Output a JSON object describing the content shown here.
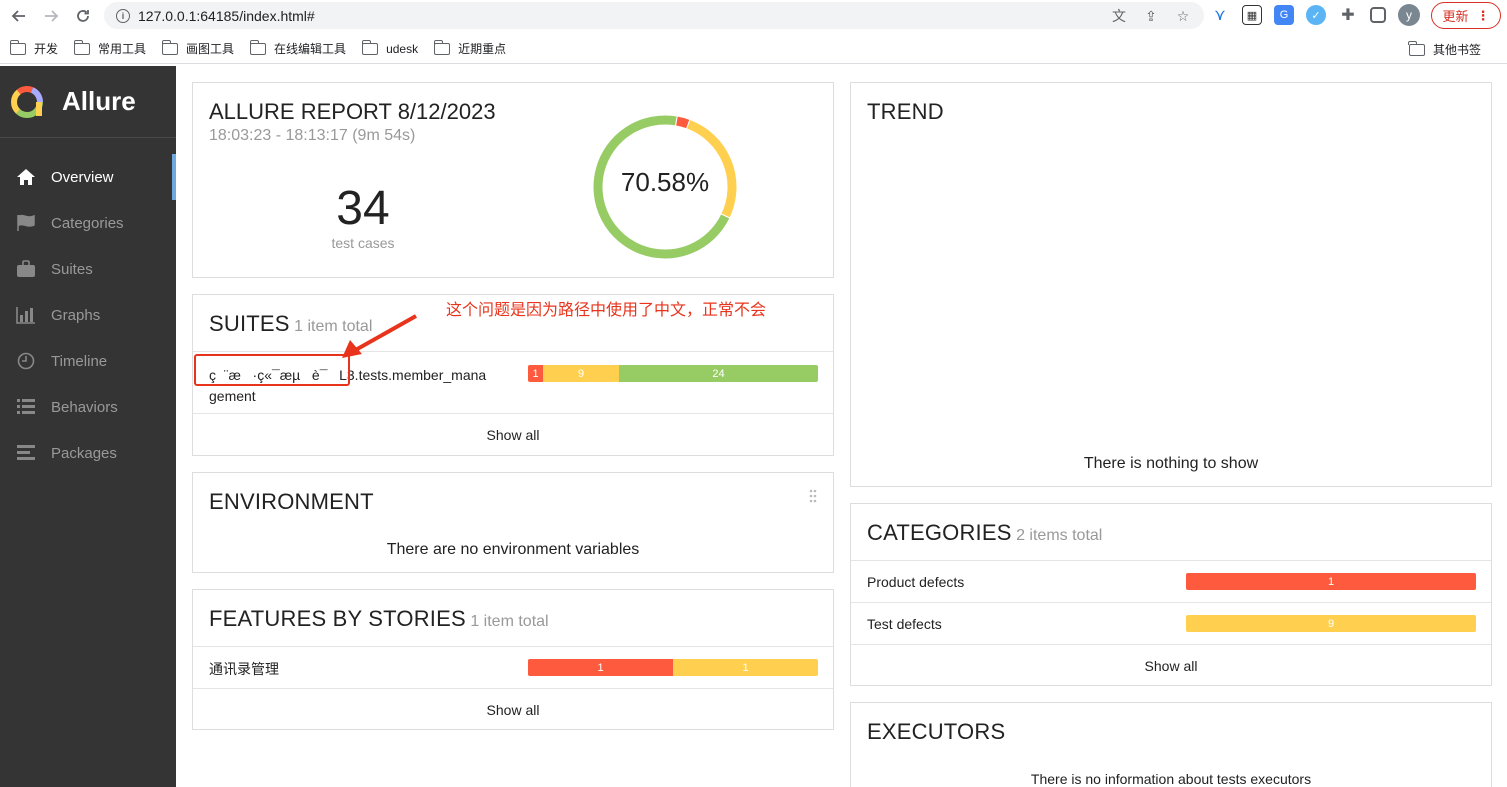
{
  "browser": {
    "url": "127.0.0.1:64185/index.html#",
    "update_label": "更新",
    "avatar_letter": "y",
    "bookmarks": [
      "开发",
      "常用工具",
      "画图工具",
      "在线编辑工具",
      "udesk",
      "近期重点"
    ],
    "bookmarks_right": "其他书签"
  },
  "sidebar": {
    "brand": "Allure",
    "items": [
      {
        "label": "Overview",
        "icon": "home-icon",
        "active": true
      },
      {
        "label": "Categories",
        "icon": "flag-icon",
        "active": false
      },
      {
        "label": "Suites",
        "icon": "briefcase-icon",
        "active": false
      },
      {
        "label": "Graphs",
        "icon": "bar-chart-icon",
        "active": false
      },
      {
        "label": "Timeline",
        "icon": "clock-icon",
        "active": false
      },
      {
        "label": "Behaviors",
        "icon": "list-icon",
        "active": false
      },
      {
        "label": "Packages",
        "icon": "align-left-icon",
        "active": false
      }
    ]
  },
  "summary": {
    "title": "ALLURE REPORT 8/12/2023",
    "time_range": "18:03:23 - 18:13:17 (9m 54s)",
    "test_count": "34",
    "test_count_label": "test cases",
    "percent": "70.58%",
    "donut_values": {
      "failed": 1,
      "broken": 9,
      "passed": 24
    }
  },
  "suites": {
    "title": "SUITES",
    "subtitle": "1 item total",
    "row_label_line1": "ç  ¨æ   ·ç«¯æµ   è¯   L3.tests.member_mana",
    "row_label_line2": "gement",
    "bar": {
      "failed": "1",
      "broken": "9",
      "passed": "24"
    },
    "show_all": "Show all",
    "annotation": "这个问题是因为路径中使用了中文，正常不会"
  },
  "environment": {
    "title": "ENVIRONMENT",
    "empty": "There are no environment variables"
  },
  "features": {
    "title": "FEATURES BY STORIES",
    "subtitle": "1 item total",
    "row_label": "通讯录管理",
    "bar": {
      "failed": "1",
      "broken": "1"
    },
    "show_all": "Show all"
  },
  "trend": {
    "title": "TREND",
    "empty": "There is nothing to show"
  },
  "categories": {
    "title": "CATEGORIES",
    "subtitle": "2 items total",
    "rows": [
      {
        "label": "Product defects",
        "value": "1",
        "status": "failed"
      },
      {
        "label": "Test defects",
        "value": "9",
        "status": "broken"
      }
    ],
    "show_all": "Show all"
  },
  "executors": {
    "title": "EXECUTORS",
    "empty": "There is no information about tests executors"
  },
  "colors": {
    "failed": "#fd5a3e",
    "broken": "#ffd050",
    "passed": "#97cc64",
    "sidebar_bg": "#343434",
    "annotation": "#e8341c"
  }
}
